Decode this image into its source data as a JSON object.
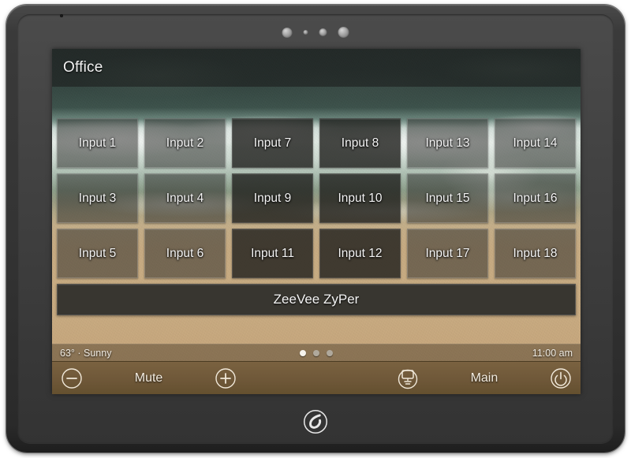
{
  "device": {
    "type": "crestron-touch-panel",
    "home_button_icon": "crestron-logo-icon",
    "sensors": [
      "camera-icon",
      "light-sensor-icon",
      "proximity-sensor-icon",
      "status-led-icon"
    ]
  },
  "screen": {
    "header": {
      "title": "Office"
    },
    "grid": {
      "columns": 6,
      "rows": 3,
      "buttons": [
        {
          "label": "Input 1",
          "style": "light"
        },
        {
          "label": "Input 2",
          "style": "light"
        },
        {
          "label": "Input 7",
          "style": "dark"
        },
        {
          "label": "Input 8",
          "style": "dark"
        },
        {
          "label": "Input 13",
          "style": "light"
        },
        {
          "label": "Input 14",
          "style": "light"
        },
        {
          "label": "Input 3",
          "style": "light"
        },
        {
          "label": "Input 4",
          "style": "light"
        },
        {
          "label": "Input 9",
          "style": "dark"
        },
        {
          "label": "Input 10",
          "style": "dark"
        },
        {
          "label": "Input 15",
          "style": "light"
        },
        {
          "label": "Input 16",
          "style": "light"
        },
        {
          "label": "Input 5",
          "style": "light"
        },
        {
          "label": "Input 6",
          "style": "light"
        },
        {
          "label": "Input 11",
          "style": "dark"
        },
        {
          "label": "Input 12",
          "style": "dark"
        },
        {
          "label": "Input 17",
          "style": "light"
        },
        {
          "label": "Input 18",
          "style": "light"
        }
      ]
    },
    "wide_button": {
      "label": "ZeeVee ZyPer"
    },
    "status_bar": {
      "weather": "63° · Sunny",
      "clock": "11:00 am",
      "pages": {
        "count": 3,
        "active_index": 0
      }
    },
    "control_bar": {
      "volume_down_icon": "minus-circle-icon",
      "mute_label": "Mute",
      "volume_up_icon": "plus-circle-icon",
      "display_icon": "display-circle-icon",
      "room_label": "Main",
      "power_icon": "power-circle-icon"
    }
  },
  "colors": {
    "bezel": "#343434",
    "sand": "#c9a97e",
    "water": "#2e3d39",
    "control_bar": "#6f5839",
    "button_light": "rgba(42,42,40,0.52)",
    "button_dark": "rgba(30,30,28,0.80)",
    "text_primary": "#f4f4f4"
  }
}
